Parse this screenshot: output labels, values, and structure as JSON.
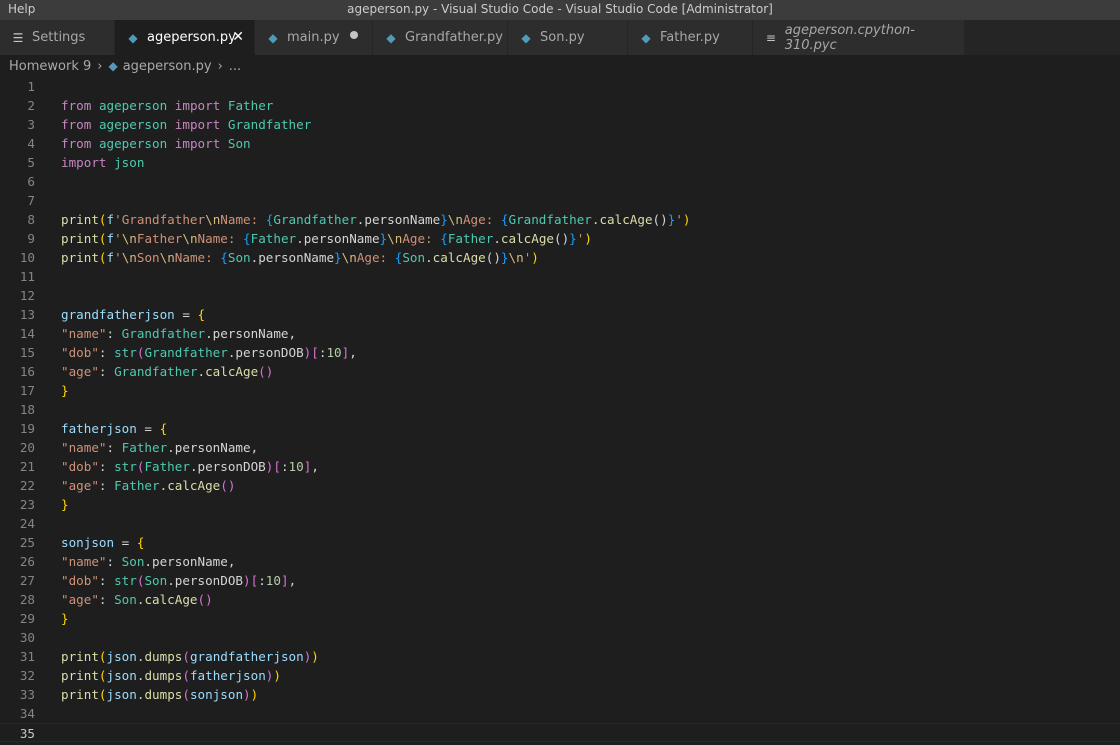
{
  "window": {
    "menu_label": "Help",
    "title": "ageperson.py - Visual Studio Code - Visual Studio Code [Administrator]"
  },
  "tabs": [
    {
      "label": "Settings",
      "icon": "settings-icon",
      "width": 115
    },
    {
      "label": "ageperson.py",
      "icon": "python-file-icon",
      "active": true,
      "close": "✕",
      "width": 140
    },
    {
      "label": "main.py",
      "icon": "python-file-icon",
      "modified": true,
      "width": 118
    },
    {
      "label": "Grandfather.py",
      "icon": "python-file-icon",
      "width": 135
    },
    {
      "label": "Son.py",
      "icon": "python-file-icon",
      "width": 120
    },
    {
      "label": "Father.py",
      "icon": "python-file-icon",
      "width": 125
    },
    {
      "label": "ageperson.cpython-310.pyc",
      "icon": "binary-file-icon",
      "italic": true,
      "width": 212
    }
  ],
  "breadcrumb": {
    "folder": "Homework 9",
    "file": "ageperson.py",
    "more": "..."
  },
  "editor": {
    "active_line": 35,
    "lines": [
      {
        "n": "1",
        "tokens": []
      },
      {
        "n": "2",
        "tokens": [
          [
            "kw",
            "from"
          ],
          [
            "plain",
            " "
          ],
          [
            "mod",
            "ageperson"
          ],
          [
            "plain",
            " "
          ],
          [
            "kw",
            "import"
          ],
          [
            "plain",
            " "
          ],
          [
            "cls",
            "Father"
          ]
        ]
      },
      {
        "n": "3",
        "tokens": [
          [
            "kw",
            "from"
          ],
          [
            "plain",
            " "
          ],
          [
            "mod",
            "ageperson"
          ],
          [
            "plain",
            " "
          ],
          [
            "kw",
            "import"
          ],
          [
            "plain",
            " "
          ],
          [
            "cls",
            "Grandfather"
          ]
        ]
      },
      {
        "n": "4",
        "tokens": [
          [
            "kw",
            "from"
          ],
          [
            "plain",
            " "
          ],
          [
            "mod",
            "ageperson"
          ],
          [
            "plain",
            " "
          ],
          [
            "kw",
            "import"
          ],
          [
            "plain",
            " "
          ],
          [
            "cls",
            "Son"
          ]
        ]
      },
      {
        "n": "5",
        "tokens": [
          [
            "kw",
            "import"
          ],
          [
            "plain",
            " "
          ],
          [
            "mod",
            "json"
          ]
        ]
      },
      {
        "n": "6",
        "tokens": []
      },
      {
        "n": "7",
        "tokens": []
      },
      {
        "n": "8",
        "tokens": [
          [
            "fn",
            "print"
          ],
          [
            "b1",
            "("
          ],
          [
            "var",
            "f"
          ],
          [
            "str",
            "'Grandfather"
          ],
          [
            "esc",
            "\\n"
          ],
          [
            "str",
            "Name: "
          ],
          [
            "b3",
            "{"
          ],
          [
            "cls",
            "Grandfather"
          ],
          [
            "attr",
            ".personName"
          ],
          [
            "b3",
            "}"
          ],
          [
            "esc",
            "\\n"
          ],
          [
            "str",
            "Age: "
          ],
          [
            "b3",
            "{"
          ],
          [
            "cls",
            "Grandfather"
          ],
          [
            "attr",
            "."
          ],
          [
            "fn",
            "calcAge"
          ],
          [
            "plain",
            "()"
          ],
          [
            "b3",
            "}"
          ],
          [
            "str",
            "'"
          ],
          [
            "b1",
            ")"
          ]
        ]
      },
      {
        "n": "9",
        "tokens": [
          [
            "fn",
            "print"
          ],
          [
            "b1",
            "("
          ],
          [
            "var",
            "f"
          ],
          [
            "str",
            "'"
          ],
          [
            "esc",
            "\\n"
          ],
          [
            "str",
            "Father"
          ],
          [
            "esc",
            "\\n"
          ],
          [
            "str",
            "Name: "
          ],
          [
            "b3",
            "{"
          ],
          [
            "cls",
            "Father"
          ],
          [
            "attr",
            ".personName"
          ],
          [
            "b3",
            "}"
          ],
          [
            "esc",
            "\\n"
          ],
          [
            "str",
            "Age: "
          ],
          [
            "b3",
            "{"
          ],
          [
            "cls",
            "Father"
          ],
          [
            "attr",
            "."
          ],
          [
            "fn",
            "calcAge"
          ],
          [
            "plain",
            "()"
          ],
          [
            "b3",
            "}"
          ],
          [
            "str",
            "'"
          ],
          [
            "b1",
            ")"
          ]
        ]
      },
      {
        "n": "10",
        "tokens": [
          [
            "fn",
            "print"
          ],
          [
            "b1",
            "("
          ],
          [
            "var",
            "f"
          ],
          [
            "str",
            "'"
          ],
          [
            "esc",
            "\\n"
          ],
          [
            "str",
            "Son"
          ],
          [
            "esc",
            "\\n"
          ],
          [
            "str",
            "Name: "
          ],
          [
            "b3",
            "{"
          ],
          [
            "cls",
            "Son"
          ],
          [
            "attr",
            ".personName"
          ],
          [
            "b3",
            "}"
          ],
          [
            "esc",
            "\\n"
          ],
          [
            "str",
            "Age: "
          ],
          [
            "b3",
            "{"
          ],
          [
            "cls",
            "Son"
          ],
          [
            "attr",
            "."
          ],
          [
            "fn",
            "calcAge"
          ],
          [
            "plain",
            "()"
          ],
          [
            "b3",
            "}"
          ],
          [
            "esc",
            "\\n"
          ],
          [
            "str",
            "'"
          ],
          [
            "b1",
            ")"
          ]
        ]
      },
      {
        "n": "11",
        "tokens": []
      },
      {
        "n": "12",
        "tokens": []
      },
      {
        "n": "13",
        "tokens": [
          [
            "var",
            "grandfatherjson"
          ],
          [
            "plain",
            " = "
          ],
          [
            "b1",
            "{"
          ]
        ]
      },
      {
        "n": "14",
        "tokens": [
          [
            "str",
            "\"name\""
          ],
          [
            "plain",
            ": "
          ],
          [
            "cls",
            "Grandfather"
          ],
          [
            "attr",
            ".personName,"
          ]
        ]
      },
      {
        "n": "15",
        "tokens": [
          [
            "str",
            "\"dob\""
          ],
          [
            "plain",
            ": "
          ],
          [
            "cls",
            "str"
          ],
          [
            "b2",
            "("
          ],
          [
            "cls",
            "Grandfather"
          ],
          [
            "attr",
            ".personDOB"
          ],
          [
            "b2",
            ")"
          ],
          [
            "b2",
            "["
          ],
          [
            "plain",
            ":"
          ],
          [
            "num",
            "10"
          ],
          [
            "b2",
            "]"
          ],
          [
            "plain",
            ","
          ]
        ]
      },
      {
        "n": "16",
        "tokens": [
          [
            "str",
            "\"age\""
          ],
          [
            "plain",
            ": "
          ],
          [
            "cls",
            "Grandfather"
          ],
          [
            "attr",
            "."
          ],
          [
            "fn",
            "calcAge"
          ],
          [
            "b2",
            "()"
          ]
        ]
      },
      {
        "n": "17",
        "tokens": [
          [
            "b1",
            "}"
          ]
        ]
      },
      {
        "n": "18",
        "tokens": []
      },
      {
        "n": "19",
        "tokens": [
          [
            "var",
            "fatherjson"
          ],
          [
            "plain",
            " = "
          ],
          [
            "b1",
            "{"
          ]
        ]
      },
      {
        "n": "20",
        "tokens": [
          [
            "str",
            "\"name\""
          ],
          [
            "plain",
            ": "
          ],
          [
            "cls",
            "Father"
          ],
          [
            "attr",
            ".personName,"
          ]
        ]
      },
      {
        "n": "21",
        "tokens": [
          [
            "str",
            "\"dob\""
          ],
          [
            "plain",
            ": "
          ],
          [
            "cls",
            "str"
          ],
          [
            "b2",
            "("
          ],
          [
            "cls",
            "Father"
          ],
          [
            "attr",
            ".personDOB"
          ],
          [
            "b2",
            ")"
          ],
          [
            "b2",
            "["
          ],
          [
            "plain",
            ":"
          ],
          [
            "num",
            "10"
          ],
          [
            "b2",
            "]"
          ],
          [
            "plain",
            ","
          ]
        ]
      },
      {
        "n": "22",
        "tokens": [
          [
            "str",
            "\"age\""
          ],
          [
            "plain",
            ": "
          ],
          [
            "cls",
            "Father"
          ],
          [
            "attr",
            "."
          ],
          [
            "fn",
            "calcAge"
          ],
          [
            "b2",
            "()"
          ]
        ]
      },
      {
        "n": "23",
        "tokens": [
          [
            "b1",
            "}"
          ]
        ]
      },
      {
        "n": "24",
        "tokens": []
      },
      {
        "n": "25",
        "tokens": [
          [
            "var",
            "sonjson"
          ],
          [
            "plain",
            " = "
          ],
          [
            "b1",
            "{"
          ]
        ]
      },
      {
        "n": "26",
        "tokens": [
          [
            "str",
            "\"name\""
          ],
          [
            "plain",
            ": "
          ],
          [
            "cls",
            "Son"
          ],
          [
            "attr",
            ".personName,"
          ]
        ]
      },
      {
        "n": "27",
        "tokens": [
          [
            "str",
            "\"dob\""
          ],
          [
            "plain",
            ": "
          ],
          [
            "cls",
            "str"
          ],
          [
            "b2",
            "("
          ],
          [
            "cls",
            "Son"
          ],
          [
            "attr",
            ".personDOB"
          ],
          [
            "b2",
            ")"
          ],
          [
            "b2",
            "["
          ],
          [
            "plain",
            ":"
          ],
          [
            "num",
            "10"
          ],
          [
            "b2",
            "]"
          ],
          [
            "plain",
            ","
          ]
        ]
      },
      {
        "n": "28",
        "tokens": [
          [
            "str",
            "\"age\""
          ],
          [
            "plain",
            ": "
          ],
          [
            "cls",
            "Son"
          ],
          [
            "attr",
            "."
          ],
          [
            "fn",
            "calcAge"
          ],
          [
            "b2",
            "()"
          ]
        ]
      },
      {
        "n": "29",
        "tokens": [
          [
            "b1",
            "}"
          ]
        ]
      },
      {
        "n": "30",
        "tokens": []
      },
      {
        "n": "31",
        "tokens": [
          [
            "fn",
            "print"
          ],
          [
            "b1",
            "("
          ],
          [
            "var",
            "json"
          ],
          [
            "attr",
            "."
          ],
          [
            "fn",
            "dumps"
          ],
          [
            "b2",
            "("
          ],
          [
            "var",
            "grandfatherjson"
          ],
          [
            "b2",
            ")"
          ],
          [
            "b1",
            ")"
          ]
        ]
      },
      {
        "n": "32",
        "tokens": [
          [
            "fn",
            "print"
          ],
          [
            "b1",
            "("
          ],
          [
            "var",
            "json"
          ],
          [
            "attr",
            "."
          ],
          [
            "fn",
            "dumps"
          ],
          [
            "b2",
            "("
          ],
          [
            "var",
            "fatherjson"
          ],
          [
            "b2",
            ")"
          ],
          [
            "b1",
            ")"
          ]
        ]
      },
      {
        "n": "33",
        "tokens": [
          [
            "fn",
            "print"
          ],
          [
            "b1",
            "("
          ],
          [
            "var",
            "json"
          ],
          [
            "attr",
            "."
          ],
          [
            "fn",
            "dumps"
          ],
          [
            "b2",
            "("
          ],
          [
            "var",
            "sonjson"
          ],
          [
            "b2",
            ")"
          ],
          [
            "b1",
            ")"
          ]
        ]
      },
      {
        "n": "34",
        "tokens": []
      },
      {
        "n": "35",
        "tokens": []
      }
    ]
  }
}
